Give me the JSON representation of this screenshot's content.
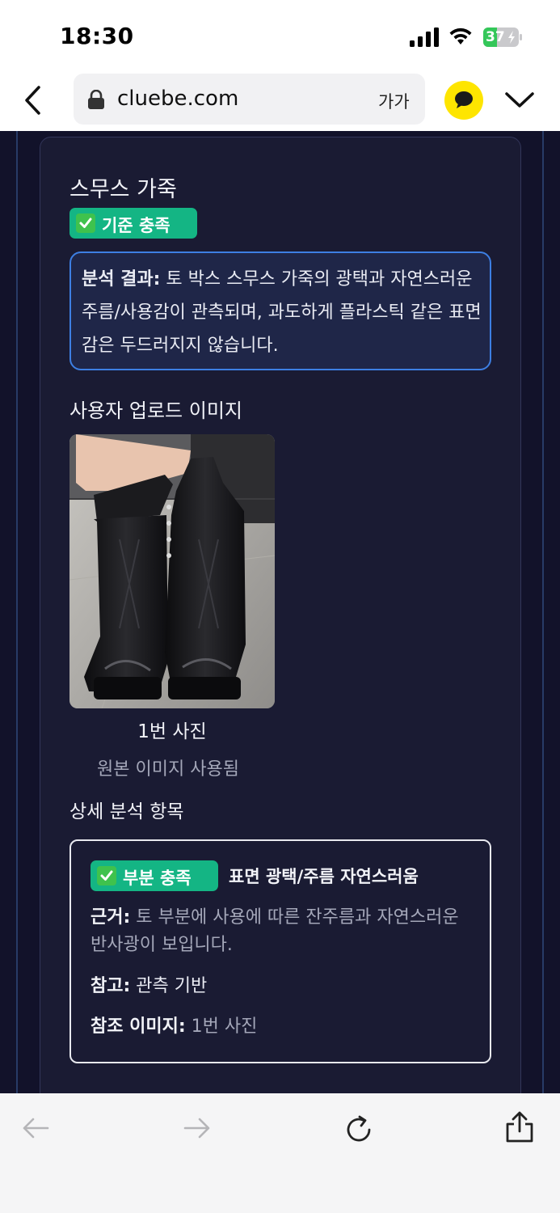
{
  "status_bar": {
    "time": "18:30",
    "battery_percent": "37",
    "icons": [
      "signal-icon",
      "wifi-icon",
      "battery-icon"
    ]
  },
  "browser": {
    "url": "cluebe.com",
    "text_size_label": "가가",
    "icons": [
      "back-icon",
      "lock-icon",
      "kakaotalk-icon",
      "menu-chevron-icon"
    ]
  },
  "card": {
    "title": "스무스 가죽",
    "status_badge": "기준 충족",
    "result_label": "분석 결과:",
    "result_text": " 토 박스 스무스 가죽의 광택과 자연스러운 주름/사용감이 관측되며, 과도하게 플라스틱 같은 표면감은 두드러지지 않습니다.",
    "upload_heading": "사용자 업로드 이미지",
    "photo_caption": "1번 사진",
    "photo_subcaption": "원본 이미지 사용됨",
    "detail_heading": "상세 분석 항목",
    "detail_item": {
      "badge": "부분 충족",
      "title": "표면 광택/주름 자연스러움",
      "basis_label": "근거:",
      "basis_text": " 토 부분에 사용에 따른 잔주름과 자연스러운 반사광이 보입니다.",
      "note_label": "참고:",
      "note_text": " 관측 기반",
      "ref_label": "참조 이미지:",
      "ref_text": " 1번 사진"
    }
  },
  "toolbar": {
    "icons": [
      "back-arrow-icon",
      "forward-arrow-icon",
      "reload-icon",
      "share-icon"
    ]
  },
  "colors": {
    "page_bg": "#12122a",
    "card_bg": "#1a1b33",
    "badge_green": "#14b584",
    "result_border": "#3d7fe3",
    "kakao_yellow": "#fee500"
  }
}
